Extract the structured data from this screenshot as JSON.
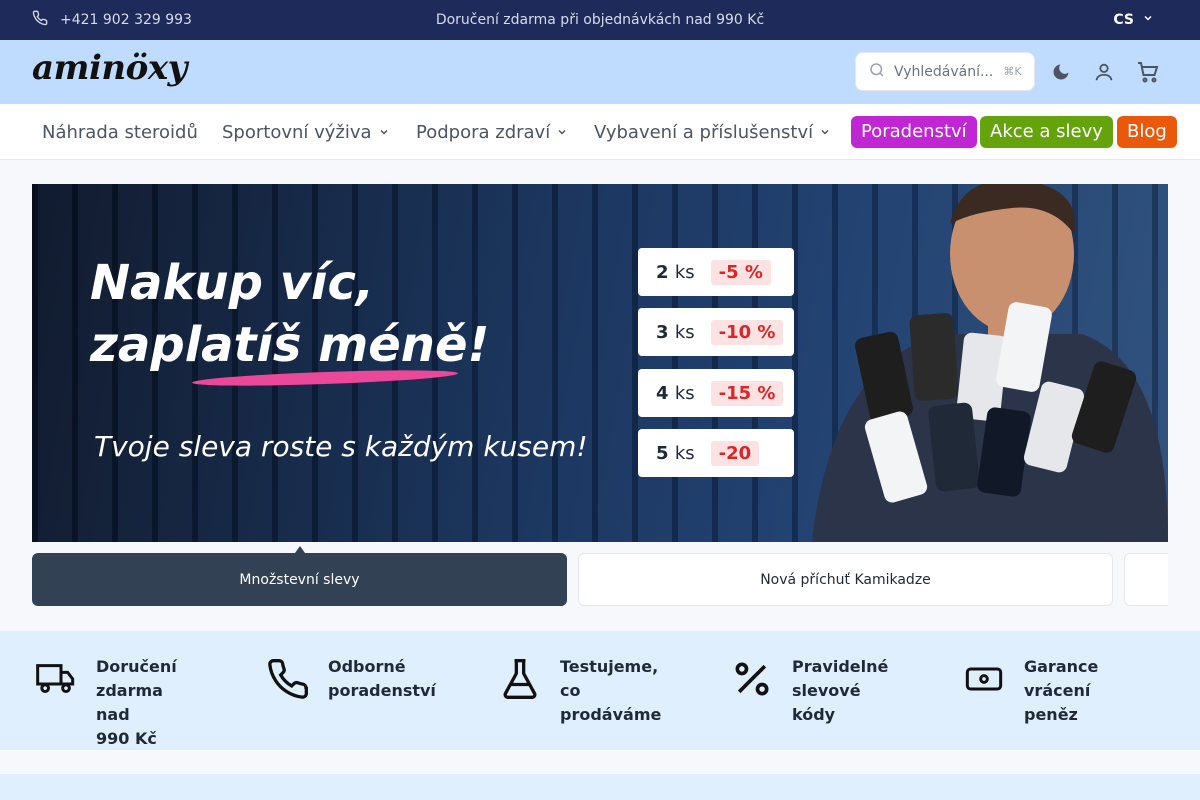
{
  "topbar": {
    "phone": "+421 902 329 993",
    "promo": "Doručení zdarma při objednávkách nad 990 Kč",
    "lang": "CS",
    "icons": {
      "phone": "phone-icon",
      "lang": "chevron-down-icon"
    }
  },
  "header": {
    "logo": "aminöxy",
    "search_placeholder": "Vyhledávání...",
    "search_shortcut": "⌘K",
    "icons": [
      "moon-icon",
      "user-icon",
      "cart-icon"
    ]
  },
  "nav": {
    "items": [
      {
        "label": "Náhrada steroidů",
        "dropdown": false
      },
      {
        "label": "Sportovní výživa",
        "dropdown": true
      },
      {
        "label": "Podpora zdraví",
        "dropdown": true
      },
      {
        "label": "Vybavení a příslušenství",
        "dropdown": true
      }
    ],
    "pills": [
      {
        "label": "Poradenství",
        "color": "#c026d3"
      },
      {
        "label": "Akce a slevy",
        "color": "#65a30d"
      },
      {
        "label": "Blog",
        "color": "#ea580c"
      }
    ]
  },
  "banner": {
    "headline_1": "Nakup víc,",
    "headline_2": "zaplatíš méně!",
    "subline": "Tvoje sleva roste s každým kusem!",
    "tiers": [
      {
        "qty": "2",
        "unit": "ks",
        "discount": "-5 %"
      },
      {
        "qty": "3",
        "unit": "ks",
        "discount": "-10 %"
      },
      {
        "qty": "4",
        "unit": "ks",
        "discount": "-15 %"
      },
      {
        "qty": "5",
        "unit": "ks",
        "discount": "-20"
      }
    ]
  },
  "slides": [
    {
      "label": "Množstevní slevy",
      "active": true
    },
    {
      "label": "Nová příchuť Kamikadze",
      "active": false
    },
    {
      "label": "",
      "active": false
    }
  ],
  "features": [
    {
      "text": "Doručení\nzdarma nad\n 990 Kč",
      "icon": "truck-icon"
    },
    {
      "text": "Odborné\nporadenství",
      "icon": "phone-icon"
    },
    {
      "text": "Testujeme, co\nprodáváme",
      "icon": "flask-icon"
    },
    {
      "text": "Pravidelné\nslevové kódy",
      "icon": "percent-icon"
    },
    {
      "text": "Garance\nvrácení peněz",
      "icon": "banknote-icon"
    }
  ]
}
